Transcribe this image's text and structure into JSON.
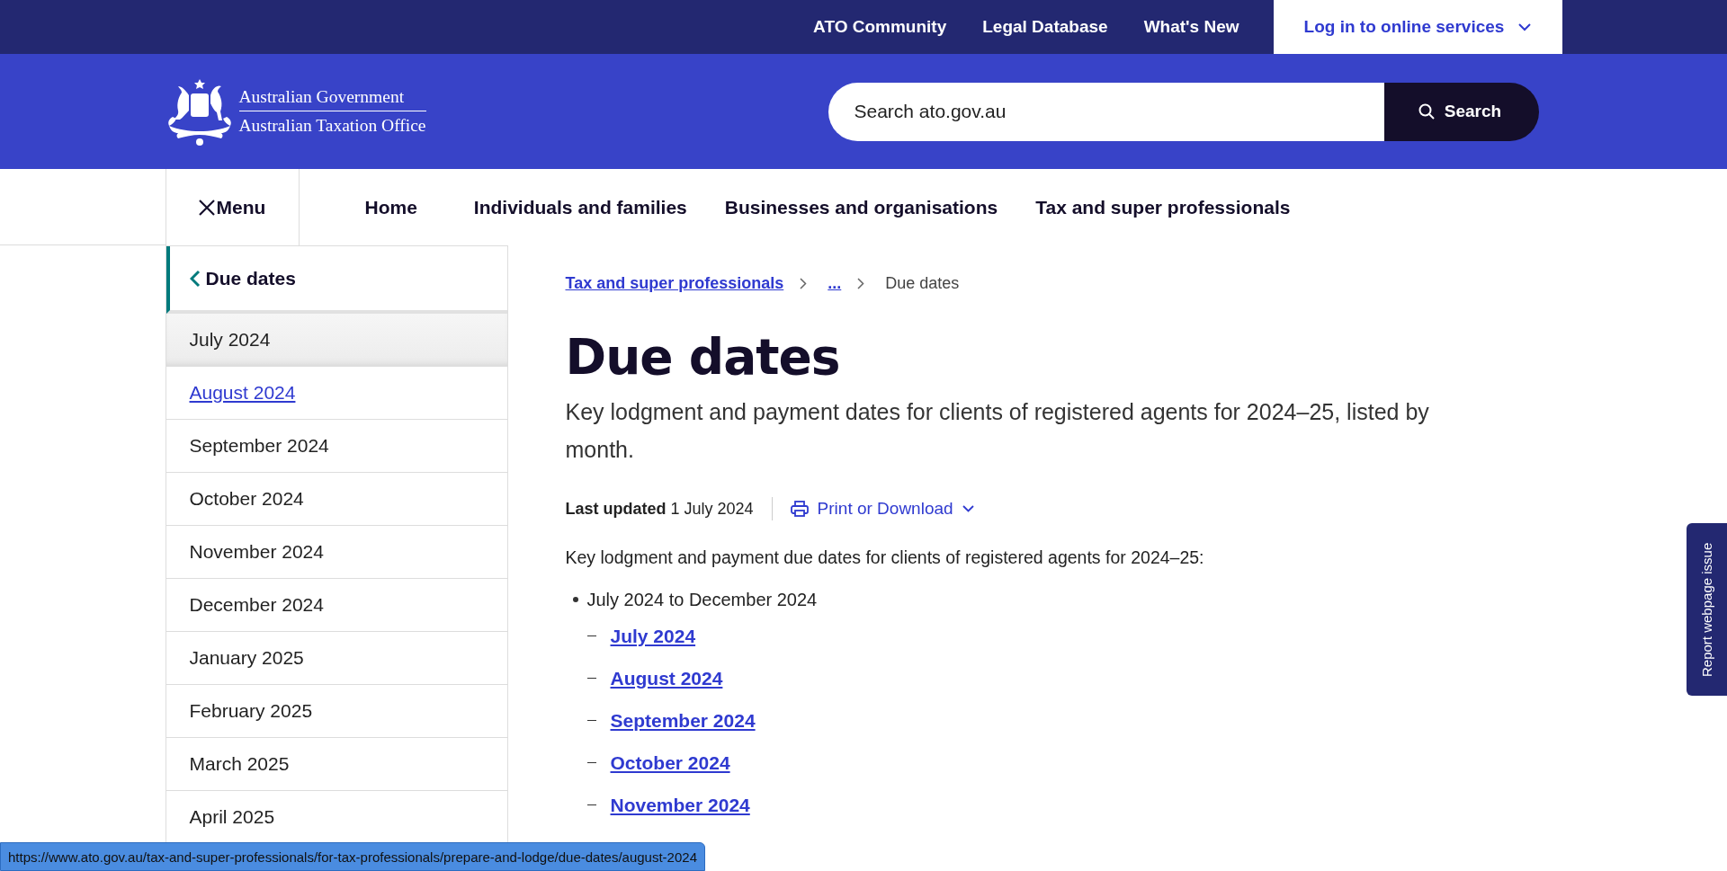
{
  "top_links": [
    {
      "label": "ATO Community"
    },
    {
      "label": "Legal Database"
    },
    {
      "label": "What's New"
    }
  ],
  "login_button": {
    "label": "Log in to online services"
  },
  "logo": {
    "line_1": "Australian Government",
    "line_2": "Australian Taxation Office"
  },
  "search": {
    "placeholder": "Search ato.gov.au",
    "button": "Search"
  },
  "menu_button": {
    "label": "Menu"
  },
  "main_nav": [
    {
      "label": "Home"
    },
    {
      "label": "Individuals and families"
    },
    {
      "label": "Businesses and organisations"
    },
    {
      "label": "Tax and super professionals"
    }
  ],
  "sidebar": {
    "heading": "Due dates",
    "items": [
      {
        "label": "July 2024",
        "selected": true,
        "hovered": false
      },
      {
        "label": "August 2024",
        "selected": false,
        "hovered": true
      },
      {
        "label": "September 2024",
        "selected": false,
        "hovered": false
      },
      {
        "label": "October 2024",
        "selected": false,
        "hovered": false
      },
      {
        "label": "November 2024",
        "selected": false,
        "hovered": false
      },
      {
        "label": "December 2024",
        "selected": false,
        "hovered": false
      },
      {
        "label": "January 2025",
        "selected": false,
        "hovered": false
      },
      {
        "label": "February 2025",
        "selected": false,
        "hovered": false
      },
      {
        "label": "March 2025",
        "selected": false,
        "hovered": false
      },
      {
        "label": "April 2025",
        "selected": false,
        "hovered": false
      }
    ]
  },
  "breadcrumb": [
    {
      "label": "Tax and super professionals",
      "kind": "link"
    },
    {
      "label": "...",
      "kind": "link"
    },
    {
      "label": "Due dates",
      "kind": "current"
    }
  ],
  "page": {
    "title": "Due dates",
    "subtitle": "Key lodgment and payment dates for clients of registered agents for 2024–25, listed by month.",
    "last_updated": "**Last updated** 1 July 2024",
    "print_button": "Print or Download",
    "intro": "Key lodgment and payment due dates for clients of registered agents for 2024–25:",
    "list": [
      {
        "label": "July 2024 to December 2024",
        "children": [
          {
            "label": "July 2024"
          },
          {
            "label": "August 2024"
          },
          {
            "label": "September 2024"
          },
          {
            "label": "October 2024"
          },
          {
            "label": "November 2024"
          }
        ]
      }
    ]
  },
  "report_tab": {
    "label": "Report webpage issue"
  },
  "status_bar": {
    "url": "https://www.ato.gov.au/tax-and-super-professionals/for-tax-professionals/prepare-and-lodge/due-dates/august-2024"
  }
}
